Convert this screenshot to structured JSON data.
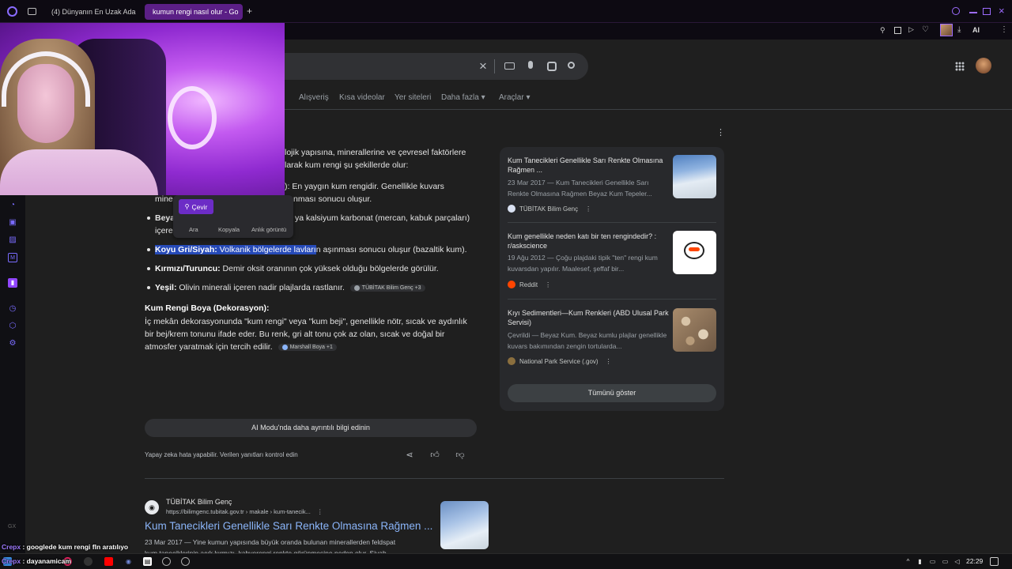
{
  "browser": {
    "tabs": [
      {
        "label": "(4) Dünyanın En Uzak Ada"
      },
      {
        "label": "kumun rengi nasıl olur - Go"
      }
    ],
    "new_tab": "+",
    "ai_label": "AI"
  },
  "search": {
    "clear": "×"
  },
  "nav": [
    {
      "label": "Alışveriş"
    },
    {
      "label": "Kısa videolar"
    },
    {
      "label": "Yer siteleri"
    },
    {
      "label": "Daha fazla ▾"
    },
    {
      "label": "Araçlar ▾"
    }
  ],
  "ai_overview": {
    "line1": "lojik yapısına, minerallerine ve çevresel faktörlere",
    "line2": "larak kum rengi şu şekillerde olur:",
    "line3": "): En yaygın kum rengidir. Genellikle kuvars",
    "line4_a": "mine",
    "line4_b": "nması sonucu oluşur.",
    "line5_a": "Beya",
    "line5_b": "ya kalsiyum karbonat (mercan, kabuk parçaları)",
    "line6": "içere",
    "b_gray_title": "Koyu Gri/Siyah:",
    "b_gray_hl": " Volkanik bölgelerde lavları",
    "b_gray_rest": "n aşınması sonucu oluşur (bazaltik kum).",
    "b_red_title": "Kırmızı/Turuncu:",
    "b_red_text": " Demir oksit oranının çok yüksek olduğu bölgelerde görülür.",
    "b_yellow_title": "Yeşil:",
    "b_yellow_text": " Olivin minerali içeren nadir plajlarda rastlanır.",
    "chip1": "TÜBİTAK Bilim Genç +3",
    "paint_title": "Kum Rengi Boya (Dekorasyon):",
    "paint_l1": "İç mekân dekorasyonunda \"kum rengi\" veya \"kum beji\", genellikle nötr, sıcak ve aydınlık",
    "paint_l2": "bir bej/krem tonunu ifade eder. Bu renk, gri alt tonu çok az olan, sıcak ve doğal bir",
    "paint_l3": "atmosfer yaratmak için tercih edilir.",
    "chip2": "Marshall Boya +1",
    "ai_mode_button": "AI Modu'nda daha ayrıntılı bilgi edinin",
    "disclaimer": "Yapay zeka hata yapabilir. Verilen yanıtları kontrol edin"
  },
  "popup": {
    "translate": "Çevir",
    "search": "Ara",
    "copy": "Kopyala",
    "screenshot": "Anlık görüntü"
  },
  "sources": [
    {
      "title": "Kum Tanecikleri Genellikle Sarı Renkte Olmasına Rağmen ...",
      "snippet": "23 Mar 2017 — Kum Tanecikleri Genellikle Sarı Renkte Olmasına Rağmen Beyaz Kum Tepeler...",
      "source": "TÜBİTAK Bilim Genç"
    },
    {
      "title": "Kum genellikle neden katı bir ten rengindedir? : r/askscience",
      "snippet": "19 Ağu 2012 — Çoğu plajdaki tipik \"ten\" rengi kum kuvarsdan yapılır. Maalesef, şeffaf bir...",
      "source": "Reddit"
    },
    {
      "title": "Kıyı Sedimentleri—Kum Renkleri (ABD Ulusal Park Servisi)",
      "snippet": "Çevrildi — Beyaz Kum. Beyaz kumlu plajlar genellikle kuvars bakımından zengin tortularda...",
      "source": "National Park Service (.gov)"
    }
  ],
  "show_all": "Tümünü göster",
  "result": {
    "site": "TÜBİTAK Bilim Genç",
    "url": "https://bilimgenc.tubitak.gov.tr › makale › kum-tanecik...",
    "title": "Kum Tanecikleri Genellikle Sarı Renkte Olmasına Rağmen ...",
    "snippet_l1": "23 Mar 2017 — Yine kumun yapısında büyük oranda bulunan minerallerden feldspat",
    "snippet_l2": "kum taneciklerinin açık kırmızı, kahverengi renkte görünmesine neden olur. Siyah"
  },
  "chat": [
    {
      "user": "Crepx",
      "text": " : googlede kum rengi fln aratılıyo"
    },
    {
      "user": "Crepx",
      "text": " : dayanamicam"
    }
  ],
  "taskbar": {
    "time": "22:29"
  },
  "sidebar_label": "GX",
  "colors": {
    "accent": "#6c2cc6",
    "link": "#8ab4f8",
    "highlight": "#264ab8",
    "background": "#1f1f1f"
  }
}
